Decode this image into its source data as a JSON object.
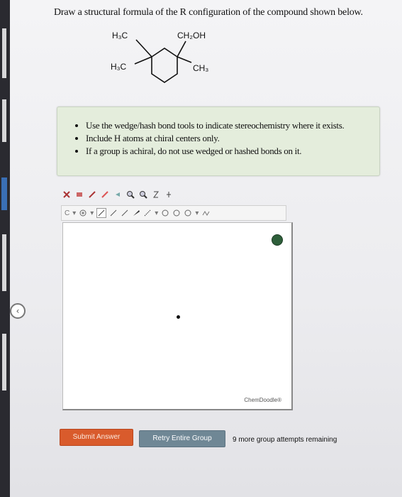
{
  "question": {
    "text": "Draw a structural formula of the R configuration of the compound shown below."
  },
  "molecule": {
    "label_h3c_top": "H₃C",
    "label_ch2oh": "CH₂OH",
    "label_h3c_left": "H₃C",
    "label_ch3": "CH₃"
  },
  "instructions": [
    "Use the wedge/hash bond tools to indicate stereochemistry where it exists.",
    "Include H atoms at chiral centers only.",
    "If a group is achiral, do not use wedged or hashed bonds on it."
  ],
  "toolbar2": {
    "element_selector": "C",
    "chevron": "▾",
    "ring_chevron": "▾"
  },
  "editor": {
    "watermark": "ChemDoodle®"
  },
  "actions": {
    "submit_label": "Submit Answer",
    "retry_label": "Retry Entire Group",
    "attempts_text": "9 more group attempts remaining"
  },
  "colors": {
    "submit": "#d95b2c",
    "retry": "#6f8795",
    "info_box": "#e4eddc"
  }
}
